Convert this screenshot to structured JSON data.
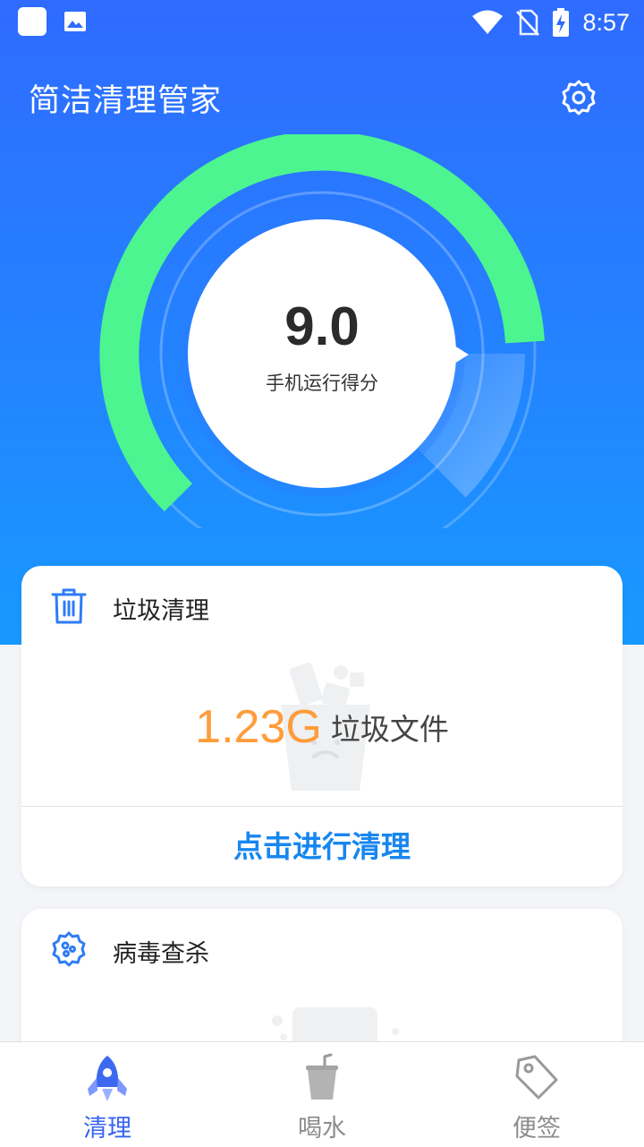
{
  "status_bar": {
    "time": "8:57",
    "icons": [
      "app-icon",
      "image-icon",
      "wifi-icon",
      "no-sim-icon",
      "battery-charging-icon"
    ]
  },
  "header": {
    "title": "简洁清理管家",
    "settings_icon": "gear-icon"
  },
  "gauge": {
    "score": "9.0",
    "label": "手机运行得分",
    "fill_fraction": 0.72,
    "colors": {
      "fill": "#4cf58f",
      "track": "#5c9bff"
    }
  },
  "junk_card": {
    "icon": "trash-icon",
    "title": "垃圾清理",
    "size": "1.23G",
    "unit_label": "垃圾文件",
    "action_label": "点击进行清理"
  },
  "virus_card": {
    "icon": "virus-icon",
    "title": "病毒查杀"
  },
  "bottom_nav": {
    "items": [
      {
        "label": "清理",
        "icon": "rocket-icon",
        "active": true
      },
      {
        "label": "喝水",
        "icon": "cup-icon",
        "active": false
      },
      {
        "label": "便签",
        "icon": "tag-icon",
        "active": false
      }
    ]
  },
  "colors": {
    "primary": "#2f6bff",
    "accent_orange": "#ff9c3a",
    "action_blue": "#1786f0",
    "nav_active": "#3763f0",
    "nav_inactive": "#8c8c8c"
  }
}
